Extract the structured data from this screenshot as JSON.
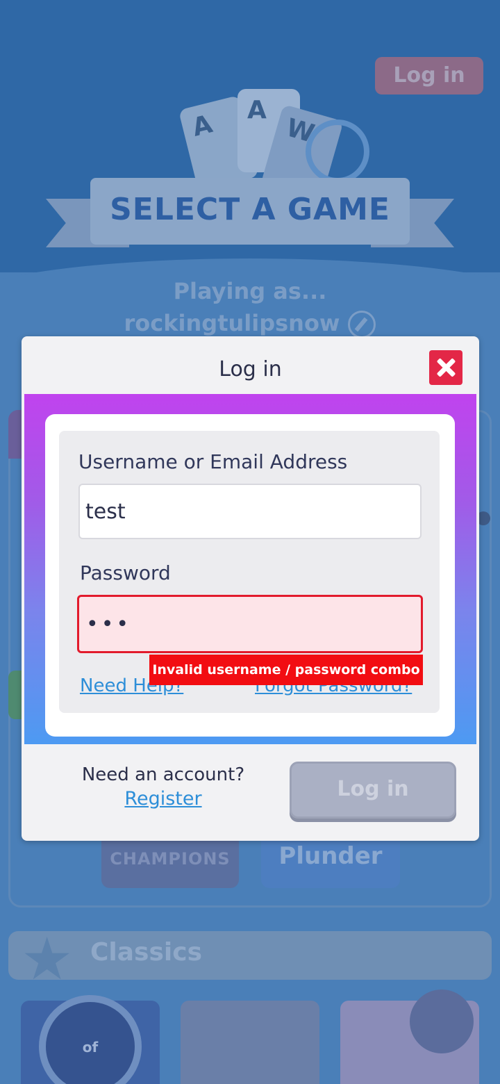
{
  "background": {
    "login_button": "Log in",
    "cards": [
      "A",
      "A",
      "W"
    ],
    "banner": "SELECT A GAME",
    "playing_as": "Playing as...",
    "username": "rockingtulipsnow",
    "tiles": [
      "CHAMPIONS",
      "Plunder"
    ],
    "section_classics": "Classics",
    "thumb_text": "of"
  },
  "modal": {
    "title": "Log in",
    "username_label": "Username or Email Address",
    "username_value": "test",
    "password_label": "Password",
    "password_value": "•••",
    "error_message": "Invalid username / password combo",
    "need_help": "Need Help?",
    "forgot_password": "Forgot Password?",
    "need_account": "Need an account?",
    "register": "Register",
    "submit": "Log in"
  },
  "icons": {
    "close": "close-icon",
    "edit": "edit-icon",
    "star": "star-icon"
  },
  "colors": {
    "close_button": "#e32747",
    "error": "#f20d12",
    "link": "#2d8ed8",
    "gradient_top": "#c043ee",
    "gradient_bottom": "#4d9af2"
  }
}
